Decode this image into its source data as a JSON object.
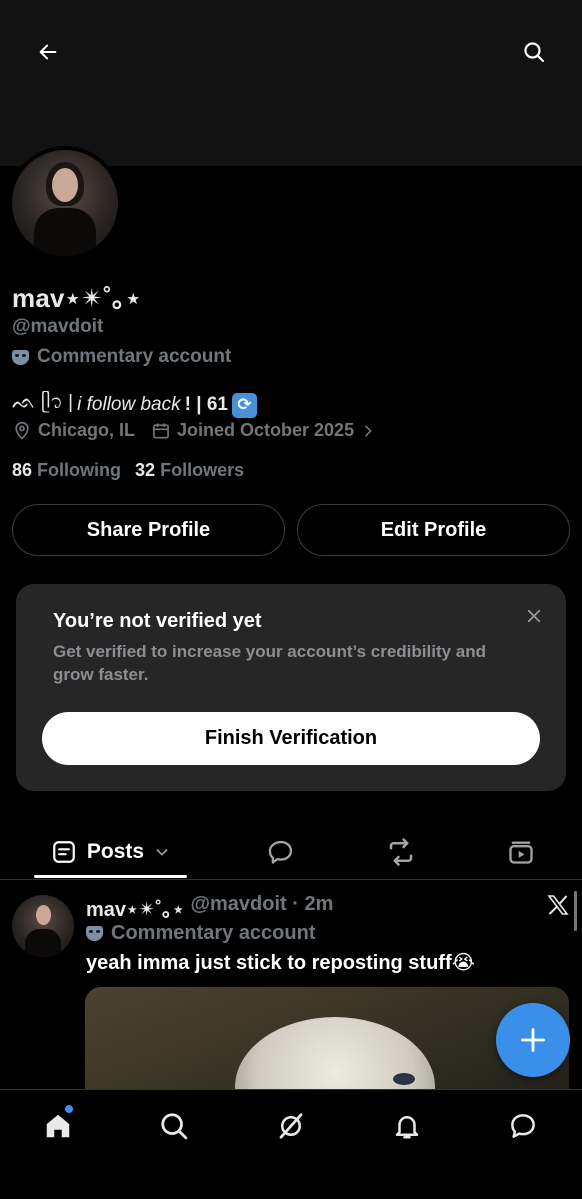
{
  "header": {
    "back_icon": "arrow-left-icon",
    "search_icon": "search-icon"
  },
  "profile": {
    "name": "mav⋆✴︎˚｡⋆",
    "handle": "@mavdoit",
    "label_icon": "mask-icon",
    "label": "Commentary account",
    "bio": {
      "prefix": "ᨒ ᥫ᭡ |",
      "italic": "i follow back",
      "suffix": "! | 61",
      "emoji_icon": "sync-icon",
      "emoji": "🔄"
    },
    "location": "Chicago, IL",
    "joined": "Joined October 2025",
    "following_count": "86",
    "following_label": "Following",
    "followers_count": "32",
    "followers_label": "Followers"
  },
  "actions": {
    "share": "Share Profile",
    "edit": "Edit Profile"
  },
  "verification": {
    "title": "You’re not verified yet",
    "text": "Get verified to increase your account’s credibility and grow faster.",
    "button": "Finish Verification"
  },
  "tabs": {
    "posts": "Posts"
  },
  "post": {
    "name": "mav⋆✴︎˚｡⋆",
    "meta": "@mavdoit · 2m",
    "label": "Commentary account",
    "text": "yeah imma just stick to reposting stuff😭"
  },
  "colors": {
    "accent": "#3a8fe8",
    "muted": "#71767b",
    "card": "#262626"
  }
}
